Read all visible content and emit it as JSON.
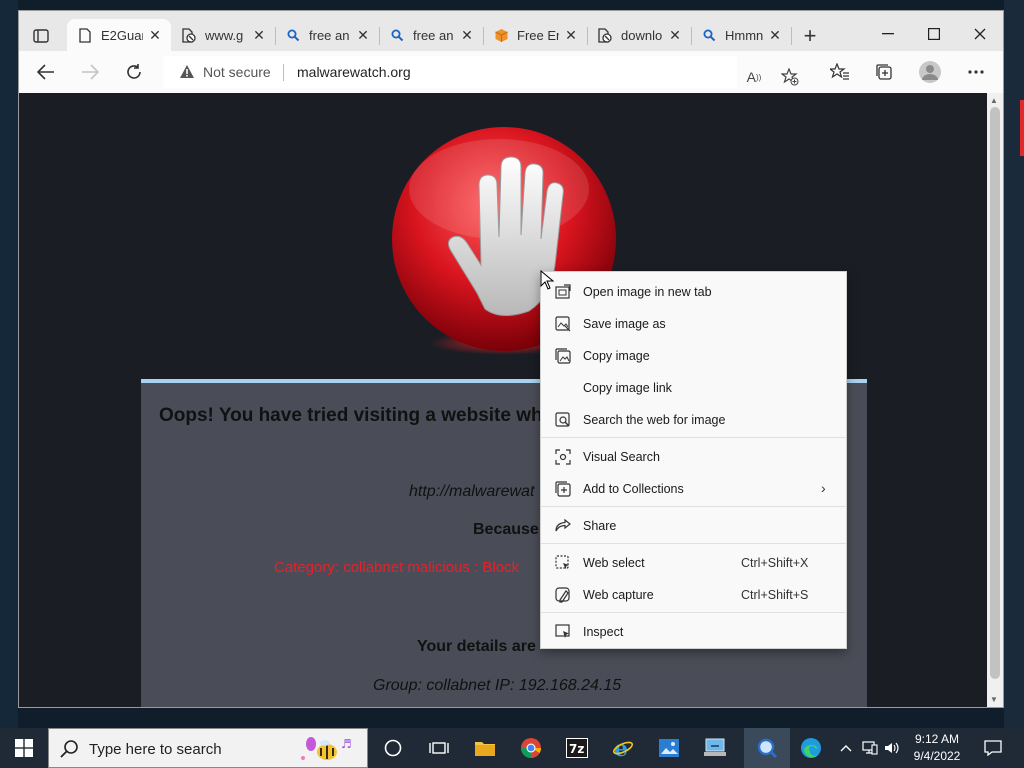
{
  "browser": {
    "tabs": [
      {
        "title": "E2Guar",
        "icon": "page-icon"
      },
      {
        "title": "www.g",
        "icon": "blocked-page-icon"
      },
      {
        "title": "free an",
        "icon": "search-icon"
      },
      {
        "title": "free an",
        "icon": "search-icon"
      },
      {
        "title": "Free Er",
        "icon": "package-icon"
      },
      {
        "title": "downlo",
        "icon": "blocked-page-icon"
      },
      {
        "title": "Hmmn",
        "icon": "search-icon"
      }
    ],
    "address": {
      "security_label": "Not secure",
      "url": "malwarewatch.org"
    }
  },
  "page": {
    "heading": "Oops! You have tried visiting a website which",
    "blocked_url": "http://malwarewat",
    "because_label": "Because",
    "category": "Category: collabnet malicious : Block",
    "details_label": "Your details are",
    "group_line": "Group: collabnet    IP: 192.168.24.15"
  },
  "context_menu": {
    "items": [
      {
        "label": "Open image in new tab",
        "icon": "open-new-tab-icon"
      },
      {
        "label": "Save image as",
        "icon": "save-image-icon"
      },
      {
        "label": "Copy image",
        "icon": "copy-image-icon"
      },
      {
        "label": "Copy image link",
        "icon": ""
      },
      {
        "label": "Search the web for image",
        "icon": "image-search-icon"
      },
      {
        "label": "Visual Search",
        "icon": "visual-search-icon"
      },
      {
        "label": "Add to Collections",
        "icon": "collections-icon"
      },
      {
        "label": "Share",
        "icon": "share-icon"
      },
      {
        "label": "Web select",
        "icon": "web-select-icon",
        "shortcut": "Ctrl+Shift+X"
      },
      {
        "label": "Web capture",
        "icon": "web-capture-icon",
        "shortcut": "Ctrl+Shift+S"
      },
      {
        "label": "Inspect",
        "icon": "inspect-icon"
      }
    ]
  },
  "taskbar": {
    "search_placeholder": "Type here to search",
    "time": "9:12 AM",
    "date": "9/4/2022"
  },
  "colors": {
    "blocked_text": "#e8202a",
    "panel_background": "#4a4d57",
    "panel_accent": "#a9d2f0",
    "stop_sign_red": "#d8141e"
  }
}
